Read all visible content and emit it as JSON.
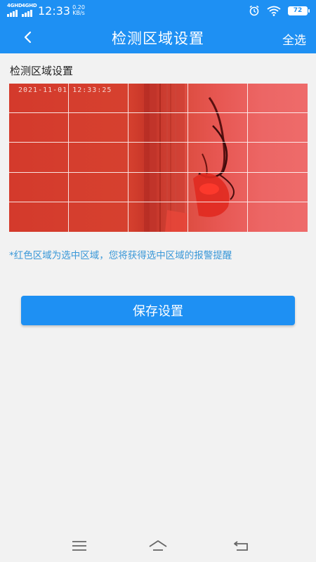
{
  "status_bar": {
    "network_1": "4GHD",
    "network_2": "4GHD",
    "time": "12:33",
    "speed_value": "0.20",
    "speed_unit": "KB/s",
    "battery": "72",
    "icons": [
      "signal-icon",
      "alarm-icon",
      "wifi-icon",
      "battery-icon"
    ]
  },
  "nav": {
    "title": "检测区域设置",
    "action": "全选",
    "back_icon": "chevron-left-icon"
  },
  "section": {
    "label": "检测区域设置"
  },
  "camera": {
    "timestamp": "2021-11-01  12:33:25",
    "grid_rows": 5,
    "grid_cols": 5,
    "selected_color": "#e0332a"
  },
  "hint": "*红色区域为选中区域，您将获得选中区域的报警提醒",
  "save_button": "保存设置",
  "bottom_nav": {
    "icons": [
      "menu-icon",
      "home-icon",
      "back-icon"
    ]
  },
  "colors": {
    "primary": "#1e90f3",
    "hint": "#3a98d8",
    "background": "#f2f2f2"
  }
}
